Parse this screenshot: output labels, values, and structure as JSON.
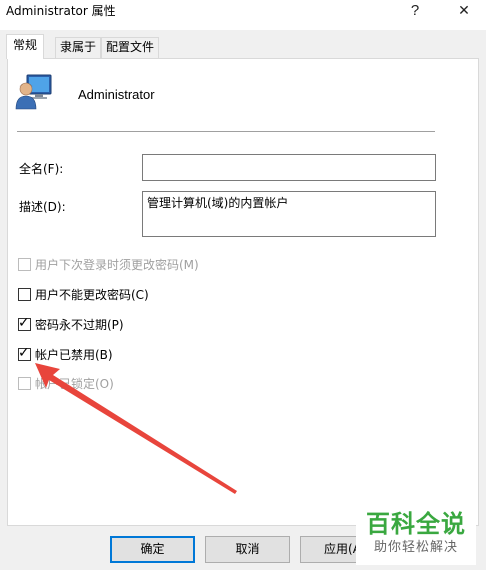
{
  "window": {
    "title": "Administrator 属性",
    "help_glyph": "?",
    "close_glyph": "✕"
  },
  "tabs": [
    {
      "label": "常规",
      "active": true
    },
    {
      "label": "隶属于",
      "active": false
    },
    {
      "label": "配置文件",
      "active": false
    }
  ],
  "user": {
    "name": "Administrator",
    "icon": "user-monitor-icon"
  },
  "fields": {
    "fullname_label": "全名(F):",
    "fullname_value": "",
    "description_label": "描述(D):",
    "description_value": "管理计算机(域)的内置帐户"
  },
  "checkboxes": [
    {
      "label": "用户下次登录时须更改密码(M)",
      "checked": false,
      "enabled": false
    },
    {
      "label": "用户不能更改密码(C)",
      "checked": false,
      "enabled": true
    },
    {
      "label": "密码永不过期(P)",
      "checked": true,
      "enabled": true
    },
    {
      "label": "帐户已禁用(B)",
      "checked": true,
      "enabled": true
    },
    {
      "label": "帐户已锁定(O)",
      "checked": false,
      "enabled": false
    }
  ],
  "buttons": {
    "ok": "确定",
    "cancel": "取消",
    "apply": "应用(A"
  },
  "annotation": {
    "arrow_color": "#e8453c"
  },
  "watermark": {
    "title": "百科全说",
    "subtitle": "助你轻松解决",
    "color": "#3aa840"
  }
}
